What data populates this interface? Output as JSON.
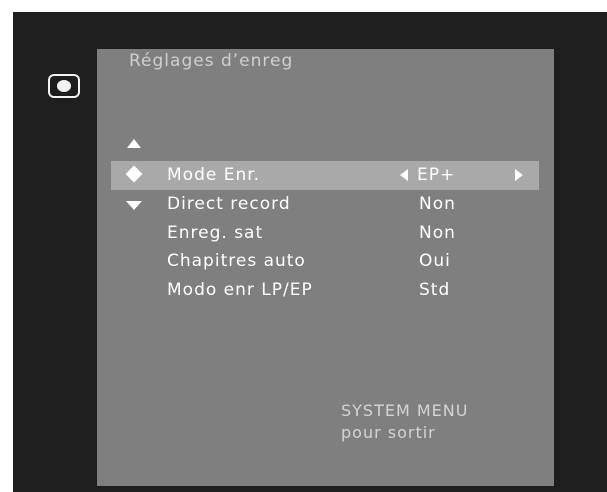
{
  "menu": {
    "title": "Réglages d’enreg",
    "items": [
      {
        "label": "Mode Enr.",
        "value": "EP+",
        "selected": true
      },
      {
        "label": "Direct record",
        "value": "Non",
        "selected": false
      },
      {
        "label": "Enreg. sat",
        "value": "Non",
        "selected": false
      },
      {
        "label": "Chapitres auto",
        "value": "Oui",
        "selected": false
      },
      {
        "label": "Modo enr LP/EP",
        "value": "Std",
        "selected": false
      }
    ]
  },
  "footer": {
    "line1": "SYSTEM MENU",
    "line2": "pour sortir"
  },
  "icons": {
    "osd": "record-disc-icon",
    "scroll_up": "triangle-up-icon",
    "scroll_down": "triangle-down-icon",
    "cursor": "diamond-cursor-icon",
    "value_prev": "triangle-left-icon",
    "value_next": "triangle-right-icon"
  },
  "colors": {
    "screen_background": "#1e1e1e",
    "panel_background": "#7f7f7f",
    "highlight": "#a9a9a9",
    "text": "#ffffff",
    "dim_text": "#cfcfcf"
  }
}
